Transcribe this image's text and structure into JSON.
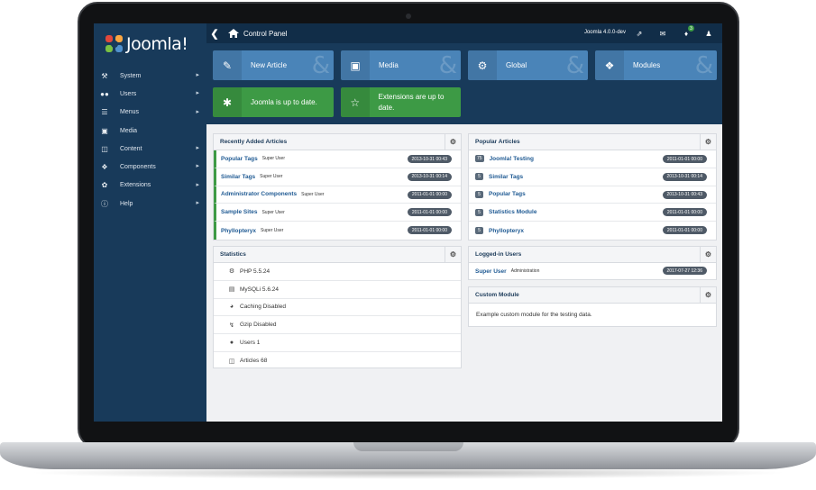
{
  "brand": {
    "logo_text": "Joomla!",
    "colors": {
      "sidebar": "#183a5a",
      "header": "#112d48",
      "tile_blue": "#4a84b8",
      "tile_green": "#3d9a45"
    }
  },
  "sidebar": {
    "items": [
      {
        "label": "System",
        "icon": "wrench-icon",
        "has_submenu": true
      },
      {
        "label": "Users",
        "icon": "users-icon",
        "has_submenu": true
      },
      {
        "label": "Menus",
        "icon": "list-icon",
        "has_submenu": true
      },
      {
        "label": "Media",
        "icon": "image-icon",
        "has_submenu": false
      },
      {
        "label": "Content",
        "icon": "file-icon",
        "has_submenu": true
      },
      {
        "label": "Components",
        "icon": "cube-icon",
        "has_submenu": true
      },
      {
        "label": "Extensions",
        "icon": "puzzle-icon",
        "has_submenu": true
      },
      {
        "label": "Help",
        "icon": "info-icon",
        "has_submenu": true
      }
    ]
  },
  "header": {
    "title": "Control Panel",
    "version": "Joomla 4.0.0-dev",
    "notification_count": "3"
  },
  "quick_icons": {
    "new_article": "New Article",
    "media": "Media",
    "global": "Global",
    "modules": "Modules",
    "joomla_status": "Joomla is up to date.",
    "extensions_status": "Extensions are up to date."
  },
  "recent_articles": {
    "title": "Recently Added Articles",
    "rows": [
      {
        "title": "Popular Tags",
        "author": "Super User",
        "date": "2013-10-31 00:43"
      },
      {
        "title": "Similar Tags",
        "author": "Super User",
        "date": "2013-10-31 00:14"
      },
      {
        "title": "Administrator Components",
        "author": "Super User",
        "date": "2011-01-01 00:00"
      },
      {
        "title": "Sample Sites",
        "author": "Super User",
        "date": "2011-01-01 00:00"
      },
      {
        "title": "Phyllopteryx",
        "author": "Super User",
        "date": "2011-01-01 00:00"
      }
    ]
  },
  "popular_articles": {
    "title": "Popular Articles",
    "rows": [
      {
        "hits": "75",
        "title": "Joomla! Testing",
        "date": "2011-01-01 00:00"
      },
      {
        "hits": "5",
        "title": "Similar Tags",
        "date": "2013-10-31 00:14"
      },
      {
        "hits": "5",
        "title": "Popular Tags",
        "date": "2013-10-31 00:43"
      },
      {
        "hits": "5",
        "title": "Statistics Module",
        "date": "2011-01-01 00:00"
      },
      {
        "hits": "5",
        "title": "Phyllopteryx",
        "date": "2011-01-01 00:00"
      }
    ]
  },
  "statistics": {
    "title": "Statistics",
    "rows": [
      {
        "icon": "cogs-icon",
        "label": "PHP 5.5.24"
      },
      {
        "icon": "database-icon",
        "label": "MySQLi 5.6.24"
      },
      {
        "icon": "dashboard-icon",
        "label": "Caching Disabled"
      },
      {
        "icon": "bolt-icon",
        "label": "Gzip Disabled"
      },
      {
        "icon": "users-icon",
        "label": "Users 1"
      },
      {
        "icon": "file-icon",
        "label": "Articles 68"
      }
    ]
  },
  "logged_in": {
    "title": "Logged-in Users",
    "rows": [
      {
        "name": "Super User",
        "role": "Administration",
        "date": "2017-07-27 12:36"
      }
    ]
  },
  "custom_module": {
    "title": "Custom Module",
    "text": "Example custom module for the testing data."
  }
}
